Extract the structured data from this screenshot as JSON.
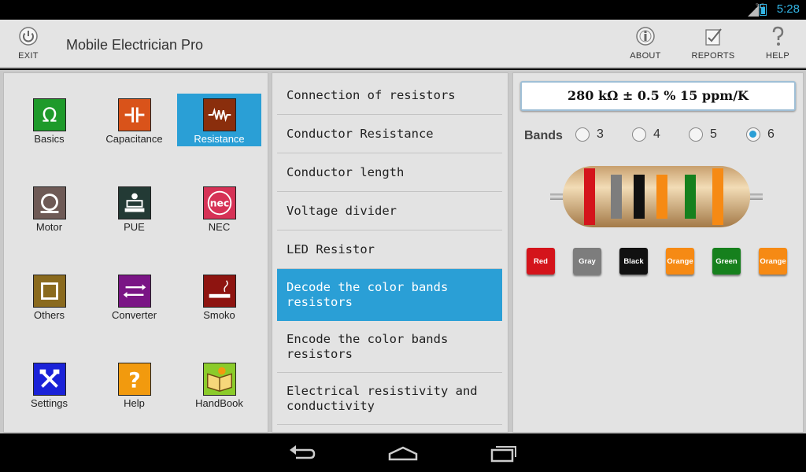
{
  "status": {
    "network": "3G",
    "time": "5:28"
  },
  "actionbar": {
    "exit_label": "EXIT",
    "title": "Mobile Electrician Pro",
    "about_label": "ABOUT",
    "reports_label": "REPORTS",
    "help_label": "HELP"
  },
  "categories": [
    {
      "label": "Basics",
      "icon": "omega-icon",
      "color": "#1e9a2a"
    },
    {
      "label": "Capacitance",
      "icon": "capacitor-icon",
      "color": "#d9531a"
    },
    {
      "label": "Resistance",
      "icon": "resistor-icon",
      "color": "#8a2e0c",
      "selected": true
    },
    {
      "label": "Motor",
      "icon": "motor-icon",
      "color": "#6e5a56"
    },
    {
      "label": "PUE",
      "icon": "pue-icon",
      "color": "#233a35"
    },
    {
      "label": "NEC",
      "icon": "nec-icon",
      "color": "#d63256"
    },
    {
      "label": "Others",
      "icon": "square-icon",
      "color": "#8a6a1e"
    },
    {
      "label": "Converter",
      "icon": "converter-icon",
      "color": "#7a1585"
    },
    {
      "label": "Smoko",
      "icon": "cigarette-icon",
      "color": "#8e1410"
    },
    {
      "label": "Settings",
      "icon": "tools-icon",
      "color": "#1a22d8"
    },
    {
      "label": "Help",
      "icon": "question-icon",
      "color": "#f29a0e"
    },
    {
      "label": "HandBook",
      "icon": "book-icon",
      "color": "#8bcb2a"
    }
  ],
  "calc_list": [
    {
      "label": "Connection of resistors"
    },
    {
      "label": "Conductor Resistance"
    },
    {
      "label": "Conductor length"
    },
    {
      "label": "Voltage divider"
    },
    {
      "label": "LED Resistor"
    },
    {
      "label": "Decode the color bands resistors",
      "selected": true
    },
    {
      "label": "Encode the color bands resistors"
    },
    {
      "label": "Electrical resistivity and conductivity"
    }
  ],
  "resistor": {
    "result": "280 kΩ ± 0.5 % 15 ppm/K",
    "bands_label": "Bands",
    "band_options": [
      "3",
      "4",
      "5",
      "6"
    ],
    "selected_band_option": "6",
    "bands": [
      {
        "name": "Red",
        "color": "#d4141b"
      },
      {
        "name": "Gray",
        "color": "#7d7d7d"
      },
      {
        "name": "Black",
        "color": "#111111"
      },
      {
        "name": "Orange",
        "color": "#f68a14"
      },
      {
        "name": "Green",
        "color": "#16801d"
      },
      {
        "name": "Orange",
        "color": "#f68a14"
      }
    ]
  }
}
